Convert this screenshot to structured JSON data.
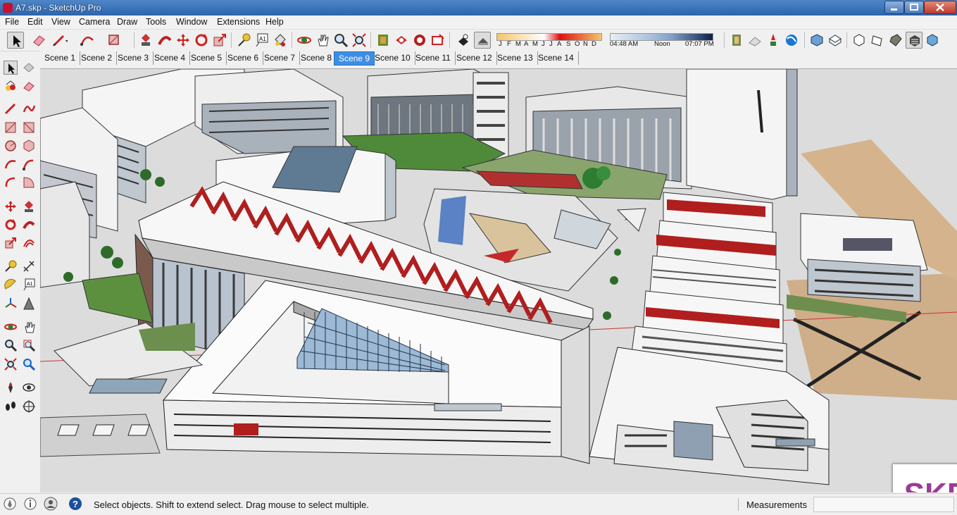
{
  "window": {
    "title": "A7.skp - SketchUp Pro"
  },
  "menu": [
    "File",
    "Edit",
    "View",
    "Camera",
    "Draw",
    "Tools",
    "Window",
    "Extensions",
    "Help"
  ],
  "shadows": {
    "months": [
      "J",
      "F",
      "M",
      "A",
      "M",
      "J",
      "J",
      "A",
      "S",
      "O",
      "N",
      "D"
    ],
    "time_start": "04:48 AM",
    "time_mid": "Noon",
    "time_end": "07:07 PM"
  },
  "scenes": {
    "tabs": [
      "Scene 1",
      "Scene 2",
      "Scene 3",
      "Scene 4",
      "Scene 5",
      "Scene 6",
      "Scene 7",
      "Scene 8",
      "Scene 9",
      "Scene 10",
      "Scene 11",
      "Scene 12",
      "Scene 13",
      "Scene 14"
    ],
    "active": "Scene 9"
  },
  "status": {
    "message": "Select objects. Shift to extend select. Drag mouse to select multiple.",
    "measurements_label": "Measurements",
    "measurements_value": ""
  },
  "viewport": {
    "watermark": "SKP"
  },
  "colors": {
    "accent": "#3d8ee6",
    "title_bar": "#2c64ad",
    "roof_red": "#b01e1e",
    "watermark": "#9b3b95"
  },
  "icons": {
    "top_toolbar": [
      "select-icon",
      "eraser-icon",
      "pencil-icon",
      "arc-icon",
      "rectangle-icon",
      "push-pull-icon",
      "follow-me-icon",
      "move-icon",
      "rotate-icon",
      "scale-icon",
      "tape-measure-icon",
      "text-icon",
      "paint-bucket-icon",
      "orbit-icon",
      "pan-icon",
      "zoom-icon",
      "zoom-extents-icon",
      "component-icon",
      "3d-warehouse-icon",
      "extension-warehouse-icon",
      "layout-icon",
      "shadow-toggle-icon",
      "fog-icon",
      "section-plane-icon",
      "geo-location-icon",
      "iso-view-icon",
      "top-view-icon",
      "front-view-icon",
      "right-view-icon",
      "back-view-icon",
      "left-view-icon",
      "xray-icon",
      "monochrome-icon"
    ],
    "left_toolbar": [
      "select-icon",
      "make-component-icon",
      "paint-bucket-icon",
      "eraser-icon",
      "line-icon",
      "freehand-icon",
      "rectangle-icon",
      "rotated-rectangle-icon",
      "circle-icon",
      "polygon-icon",
      "arc-icon",
      "pie-icon",
      "two-point-arc-icon",
      "three-point-arc-icon",
      "move-icon",
      "push-pull-icon",
      "rotate-icon",
      "follow-me-icon",
      "scale-icon",
      "offset-icon",
      "tape-measure-icon",
      "dimension-icon",
      "protractor-icon",
      "text-icon",
      "axes-icon",
      "3d-text-icon",
      "orbit-icon",
      "pan-icon",
      "zoom-icon",
      "zoom-window-icon",
      "zoom-extents-icon",
      "previous-view-icon",
      "position-camera-icon",
      "look-around-icon",
      "walk-icon",
      "section-plane-icon"
    ]
  }
}
